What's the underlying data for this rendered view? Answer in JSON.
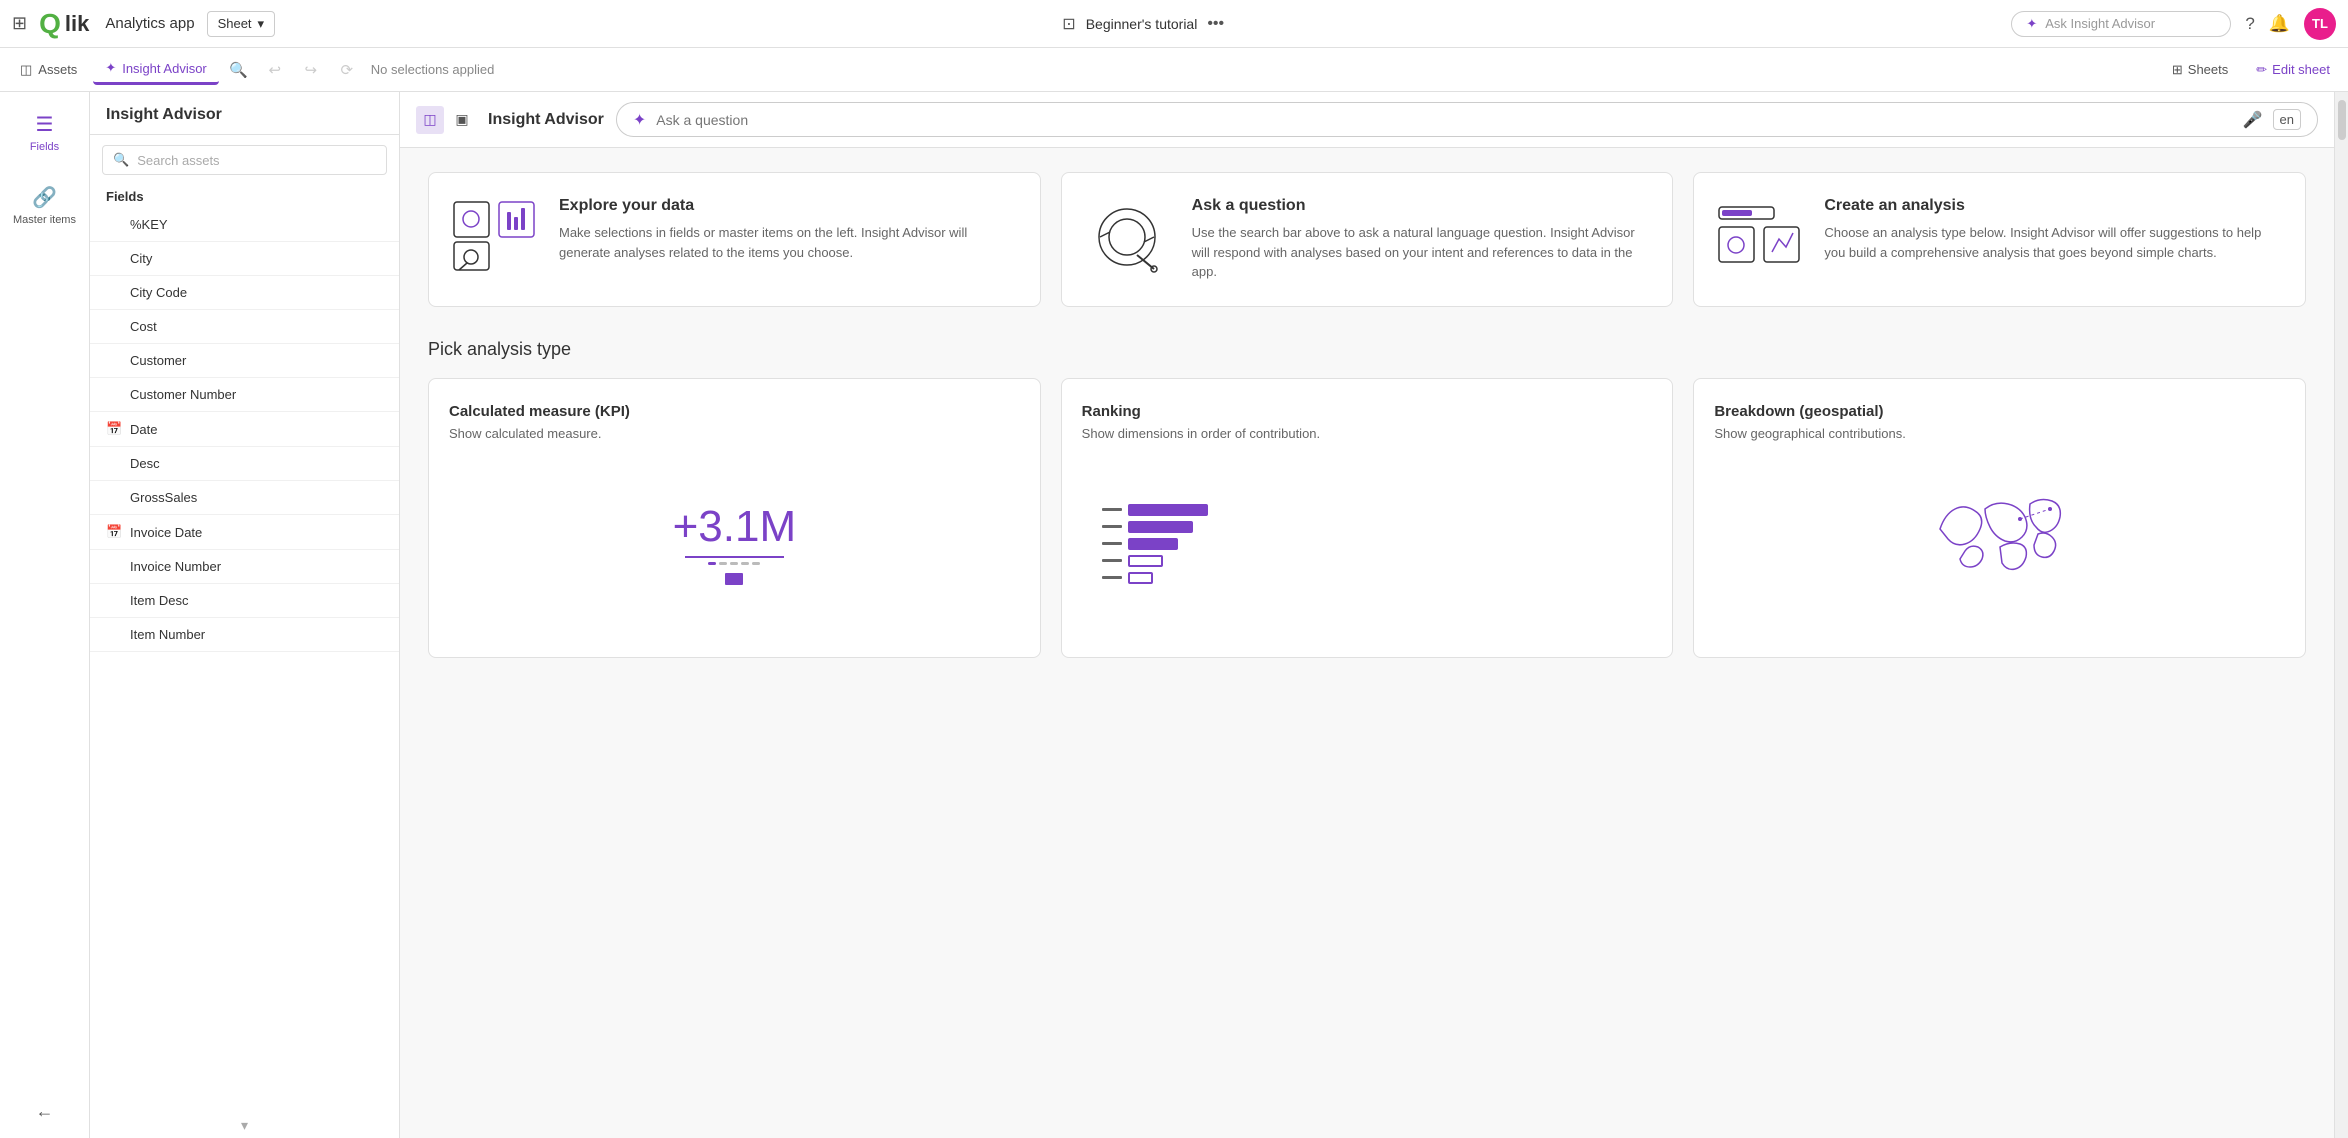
{
  "topnav": {
    "grid_icon": "⊞",
    "logo_q": "Q",
    "logo_lik": "lik",
    "app_name": "Analytics app",
    "sheet_dropdown": "Sheet",
    "tutorial": "Beginner's tutorial",
    "more_icon": "•••",
    "insight_placeholder": "Ask Insight Advisor",
    "help_icon": "?",
    "bell_icon": "🔔",
    "avatar": "TL"
  },
  "toolbar": {
    "assets_label": "Assets",
    "insight_label": "Insight Advisor",
    "icon1": "⊕",
    "icon2": "↩",
    "icon3": "↪",
    "icon4": "⟳",
    "selections_label": "No selections applied",
    "sheets_icon": "⊞",
    "sheets_label": "Sheets",
    "edit_label": "Edit sheet"
  },
  "left_panel": {
    "items": [
      {
        "id": "fields",
        "icon": "☰",
        "label": "Fields",
        "active": true
      },
      {
        "id": "master-items",
        "icon": "🔗",
        "label": "Master items",
        "active": false
      }
    ],
    "collapse_icon": "←"
  },
  "insight_panel": {
    "header": "Insight Advisor",
    "search_placeholder": "Search assets",
    "fields_label": "Fields",
    "fields": [
      {
        "id": "%KEY",
        "label": "%KEY",
        "icon": ""
      },
      {
        "id": "City",
        "label": "City",
        "icon": ""
      },
      {
        "id": "City Code",
        "label": "City Code",
        "icon": ""
      },
      {
        "id": "Cost",
        "label": "Cost",
        "icon": ""
      },
      {
        "id": "Customer",
        "label": "Customer",
        "icon": ""
      },
      {
        "id": "Customer Number",
        "label": "Customer Number",
        "icon": ""
      },
      {
        "id": "Date",
        "label": "Date",
        "icon": "📅"
      },
      {
        "id": "Desc",
        "label": "Desc",
        "icon": ""
      },
      {
        "id": "GrossSales",
        "label": "GrossSales",
        "icon": ""
      },
      {
        "id": "Invoice Date",
        "label": "Invoice Date",
        "icon": "📅"
      },
      {
        "id": "Invoice Number",
        "label": "Invoice Number",
        "icon": ""
      },
      {
        "id": "Item Desc",
        "label": "Item Desc",
        "icon": ""
      },
      {
        "id": "Item Number",
        "label": "Item Number",
        "icon": ""
      }
    ]
  },
  "ia_bar": {
    "title": "Insight Advisor",
    "question_placeholder": "Ask a question",
    "lang": "en",
    "mic_icon": "🎤"
  },
  "intro_cards": [
    {
      "id": "explore",
      "title": "Explore your data",
      "description": "Make selections in fields or master items on the left. Insight Advisor will generate analyses related to the items you choose."
    },
    {
      "id": "ask",
      "title": "Ask a question",
      "description": "Use the search bar above to ask a natural language question. Insight Advisor will respond with analyses based on your intent and references to data in the app."
    },
    {
      "id": "create",
      "title": "Create an analysis",
      "description": "Choose an analysis type below. Insight Advisor will offer suggestions to help you build a comprehensive analysis that goes beyond simple charts."
    }
  ],
  "analysis_section": {
    "title": "Pick analysis type",
    "cards": [
      {
        "id": "kpi",
        "title": "Calculated measure (KPI)",
        "description": "Show calculated measure.",
        "kpi_value": "+3.1M"
      },
      {
        "id": "ranking",
        "title": "Ranking",
        "description": "Show dimensions in order of contribution."
      },
      {
        "id": "geospatial",
        "title": "Breakdown (geospatial)",
        "description": "Show geographical contributions."
      }
    ]
  }
}
